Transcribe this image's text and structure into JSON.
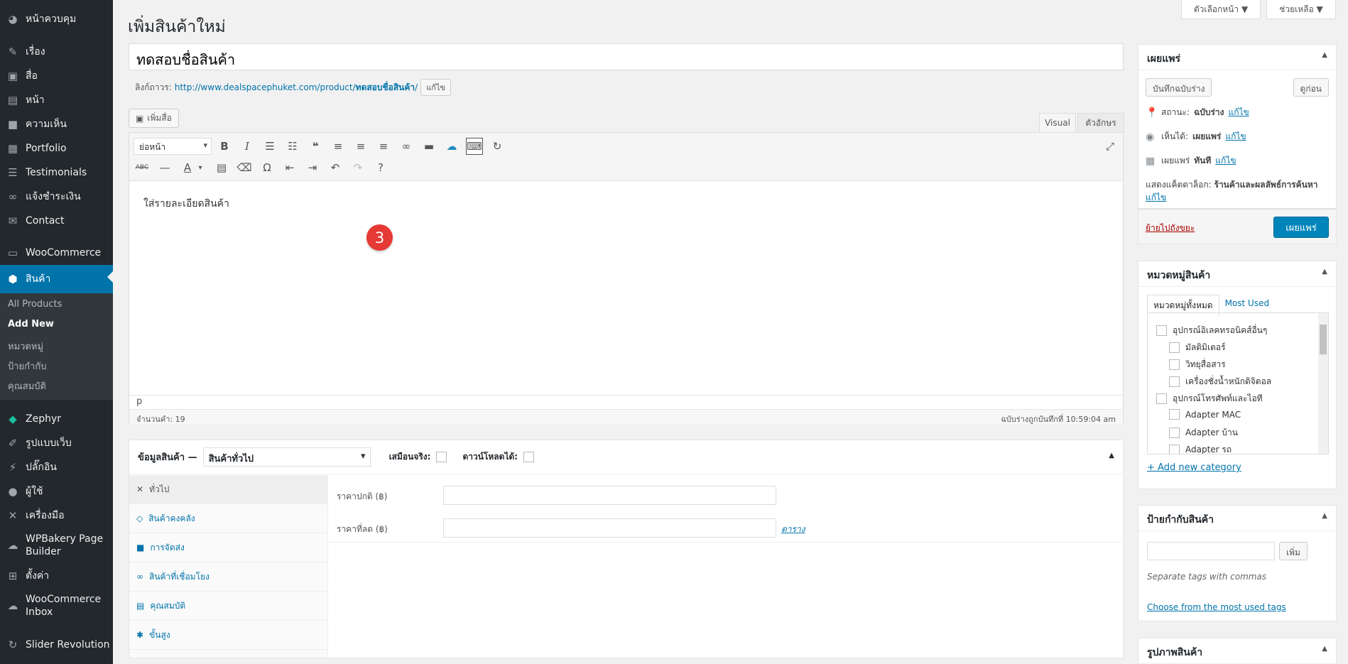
{
  "sidebar": {
    "items": [
      {
        "label": "หน้าควบคุม",
        "icon": "dashboard-icon"
      },
      {
        "label": "เรื่อง",
        "icon": "pin-icon"
      },
      {
        "label": "สื่อ",
        "icon": "media-icon"
      },
      {
        "label": "หน้า",
        "icon": "page-icon"
      },
      {
        "label": "ความเห็น",
        "icon": "comment-icon"
      },
      {
        "label": "Portfolio",
        "icon": "portfolio-icon"
      },
      {
        "label": "Testimonials",
        "icon": "testimonial-icon"
      },
      {
        "label": "แจ้งชำระเงิน",
        "icon": "link-icon"
      },
      {
        "label": "Contact",
        "icon": "mail-icon"
      },
      {
        "label": "WooCommerce",
        "icon": "woocommerce-icon"
      },
      {
        "label": "สินค้า",
        "icon": "product-box-icon"
      },
      {
        "label": "Zephyr",
        "icon": "diamond-icon"
      },
      {
        "label": "รูปแบบเว็บ",
        "icon": "brush-icon"
      },
      {
        "label": "ปลั๊กอิน",
        "icon": "plugin-icon"
      },
      {
        "label": "ผู้ใช้",
        "icon": "user-icon"
      },
      {
        "label": "เครื่องมือ",
        "icon": "wrench-icon"
      },
      {
        "label": "WPBakery Page Builder",
        "icon": "bakery-icon"
      },
      {
        "label": "ตั้งค่า",
        "icon": "settings-icon"
      },
      {
        "label": "WooCommerce Inbox",
        "icon": "inbox-icon"
      },
      {
        "label": "Slider Revolution",
        "icon": "refresh-icon"
      }
    ],
    "submenu": [
      "All Products",
      "Add New",
      "หมวดหมู่",
      "ป้ายกำกับ",
      "คุณสมบัติ"
    ]
  },
  "top": {
    "screen_options": "ตัวเลือกหน้า ▼",
    "help": "ช่วยเหลือ ▼"
  },
  "page": {
    "title": "เพิ่มสินค้าใหม่",
    "product_title": "ทดสอบชื่อสินค้า",
    "permalink_label": "ลิงก์ถาวร:",
    "permalink_base": "http://www.dealspacephuket.com/product/",
    "permalink_slug": "ทดสอบชื่อสินค้า",
    "permalink_end": "/",
    "edit_btn": "แก้ไข",
    "add_media": "เพิ่มสื่อ",
    "tab_visual": "Visual",
    "tab_text": "ตัวอักษร"
  },
  "editor": {
    "format": "ย่อหน้า",
    "content": "ใส่รายละเอียดสินค้า",
    "marker": "3",
    "path": "p",
    "word_count": "จำนวนคำ: 19",
    "draft_saved": "ฉบับร่างถูกบันทึกที่ 10:59:04 am"
  },
  "product_data": {
    "label": "ข้อมูลสินค้า —",
    "type": "สินค้าทั่วไป",
    "virtual": "เสมือนจริง:",
    "downloadable": "ดาวน์โหลดได้:",
    "tabs": [
      {
        "label": "ทั่วไป",
        "icon": "wrench-icon"
      },
      {
        "label": "สินค้าคงคลัง",
        "icon": "tag-icon"
      },
      {
        "label": "การจัดส่ง",
        "icon": "truck-icon"
      },
      {
        "label": "สินค้าที่เชื่อมโยง",
        "icon": "link-icon"
      },
      {
        "label": "คุณสมบัติ",
        "icon": "table-icon"
      },
      {
        "label": "ขั้นสูง",
        "icon": "gear-icon"
      }
    ],
    "regular_price": "ราคาปกติ (฿)",
    "sale_price": "ราคาที่ลด (฿)",
    "schedule": "ตาราง"
  },
  "publish": {
    "title": "เผยแพร่",
    "save_draft": "บันทึกฉบับร่าง",
    "preview": "ดูก่อน",
    "status_label": "สถานะ:",
    "status_value": "ฉบับร่าง",
    "visibility_label": "เห็นได้:",
    "visibility_value": "เผยแพร่",
    "publish_label": "เผยแพร่",
    "publish_value": "ทันที",
    "edit": "แก้ไข",
    "catalog_label": "แสดงแค็ตตาล็อก:",
    "catalog_value": "ร้านค้าและผลลัพธ์การค้นหา",
    "trash": "ย้ายไปถังขยะ",
    "publish_btn": "เผยแพร่"
  },
  "categories": {
    "title": "หมวดหมู่สินค้า",
    "tab_all": "หมวดหมู่ทั้งหมด",
    "tab_used": "Most Used",
    "items": [
      {
        "label": "อุปกรณ์อิเลคทรอนิคส์อื่นๆ",
        "indent": 0
      },
      {
        "label": "มัลติมิเตอร์",
        "indent": 1
      },
      {
        "label": "วิทยุสื่อสาร",
        "indent": 1
      },
      {
        "label": "เครื่องชั่งน้ำหนักดิจิตอล",
        "indent": 1
      },
      {
        "label": "อุปกรณ์โทรศัพท์และไอที",
        "indent": 0
      },
      {
        "label": "Adapter MAC",
        "indent": 1
      },
      {
        "label": "Adapter บ้าน",
        "indent": 1
      },
      {
        "label": "Adapter รถ",
        "indent": 1
      }
    ],
    "add_new": "+ Add new category"
  },
  "tags": {
    "title": "ป้ายกำกับสินค้า",
    "add_btn": "เพิ่ม",
    "hint": "Separate tags with commas",
    "choose": "Choose from the most used tags"
  },
  "image_box": {
    "title": "รูปภาพสินค้า"
  },
  "colors": {
    "sidebar": "#23282d",
    "accent": "#0073aa",
    "marker": "#e53935"
  }
}
